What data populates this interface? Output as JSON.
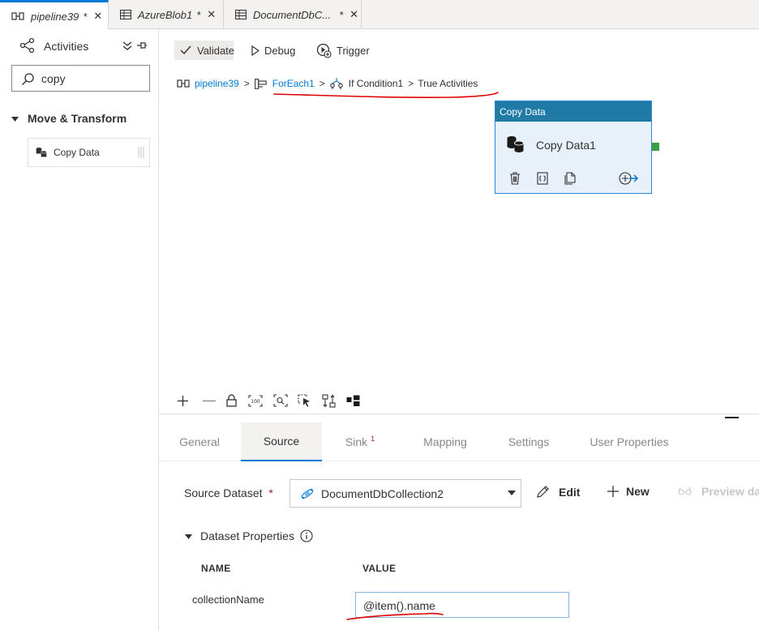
{
  "tabs": [
    {
      "label": "pipeline39",
      "modified": "*",
      "icon": "pipeline-icon"
    },
    {
      "label": "AzureBlob1",
      "modified": "*",
      "icon": "table-icon"
    },
    {
      "label": "DocumentDbC...",
      "modified": "*",
      "icon": "table-icon"
    }
  ],
  "left_panel": {
    "title": "Activities",
    "search_value": "copy",
    "category": "Move & Transform",
    "items": [
      {
        "label": "Copy Data"
      }
    ]
  },
  "toolbar": {
    "validate": "Validate",
    "debug": "Debug",
    "trigger": "Trigger"
  },
  "breadcrumb": {
    "pipeline": "pipeline39",
    "foreach": "ForEach1",
    "ifcondition": "If Condition1",
    "separator": ">",
    "tail": "True Activities"
  },
  "node": {
    "header": "Copy Data",
    "name": "Copy Data1"
  },
  "property_tabs": {
    "general": "General",
    "source": "Source",
    "sink": "Sink",
    "sink_badge": "1",
    "mapping": "Mapping",
    "settings": "Settings",
    "user_properties": "User Properties"
  },
  "source": {
    "dataset_label": "Source Dataset",
    "required_mark": "*",
    "dataset_value": "DocumentDbCollection2",
    "edit": "Edit",
    "new": "New",
    "preview": "Preview data",
    "dataset_properties": "Dataset Properties",
    "col_name": "NAME",
    "col_value": "VALUE",
    "rows": [
      {
        "name": "collectionName",
        "value": "@item().name"
      }
    ]
  },
  "colors": {
    "accent": "#0078d4",
    "node_header": "#1f7ba6",
    "annotation": "#e00000",
    "port": "#3e9d46"
  }
}
